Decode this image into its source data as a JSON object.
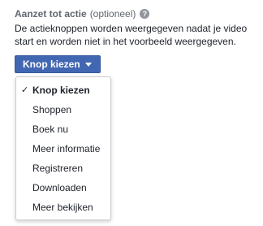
{
  "section": {
    "title": "Aanzet tot actie",
    "optional_label": "(optioneel)",
    "info_icon": "?",
    "description": "De actieknoppen worden weergegeven nadat je video start en worden niet in het voorbeeld weergegeven."
  },
  "cta_button": {
    "label": "Knop kiezen",
    "icon": "caret-down-icon"
  },
  "dropdown": {
    "selected_index": 0,
    "check_glyph": "✓",
    "items": [
      {
        "label": "Knop kiezen"
      },
      {
        "label": "Shoppen"
      },
      {
        "label": "Boek nu"
      },
      {
        "label": "Meer informatie"
      },
      {
        "label": "Registreren"
      },
      {
        "label": "Downloaden"
      },
      {
        "label": "Meer bekijken"
      }
    ]
  },
  "colors": {
    "accent": "#4267b2",
    "text": "#1d2129",
    "muted": "#606770"
  }
}
